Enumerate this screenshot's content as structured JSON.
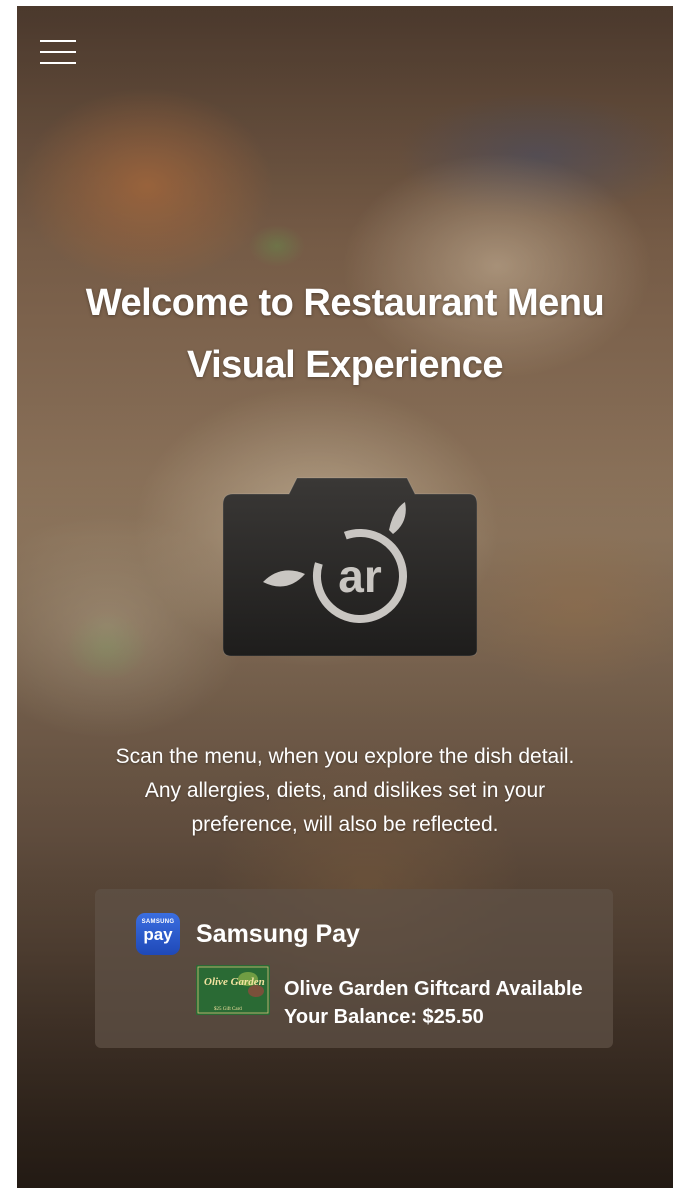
{
  "app": {
    "title_line1": "Welcome to Restaurant Menu",
    "title_line2": "Visual Experience"
  },
  "icons": {
    "menu": "hamburger-menu-icon",
    "camera": "ar-camera-icon",
    "camera_text": "ar",
    "samsung_pay": "samsung-pay-logo"
  },
  "description": {
    "line1": "Scan the menu, when you explore the dish detail.",
    "line2": "Any allergies, diets, and dislikes set in your",
    "line3": "preference, will also be reflected."
  },
  "payment": {
    "logo_small": "SAMSUNG",
    "logo_big": "pay",
    "title": "Samsung Pay",
    "giftcard_label": "Olive Garden Giftcard Available",
    "balance_label": "Your Balance: $25.50",
    "giftcard_brand": "Olive Garden",
    "giftcard_value": "$25 Gift Card"
  },
  "colors": {
    "text": "#ffffff",
    "samsung_blue": "#1f49b8",
    "card_bg": "#5f5246",
    "giftcard_green": "#2e7a3a"
  }
}
